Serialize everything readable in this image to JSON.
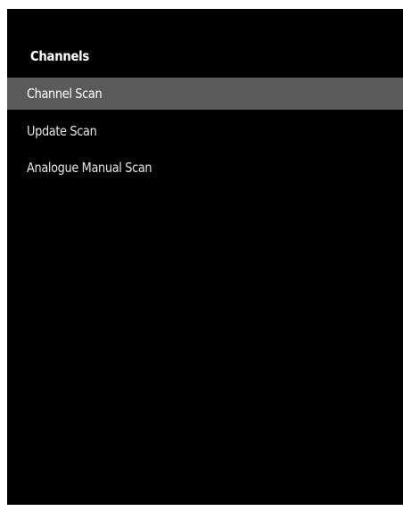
{
  "screen": {
    "title": "Channels",
    "background_color": "#000000",
    "selection_color": "#5a5a5a",
    "text_color": "#ffffff"
  },
  "menu": {
    "items": [
      {
        "label": "Channel Scan",
        "selected": true
      },
      {
        "label": "Update Scan",
        "selected": false
      },
      {
        "label": "Analogue Manual Scan",
        "selected": false
      }
    ]
  }
}
